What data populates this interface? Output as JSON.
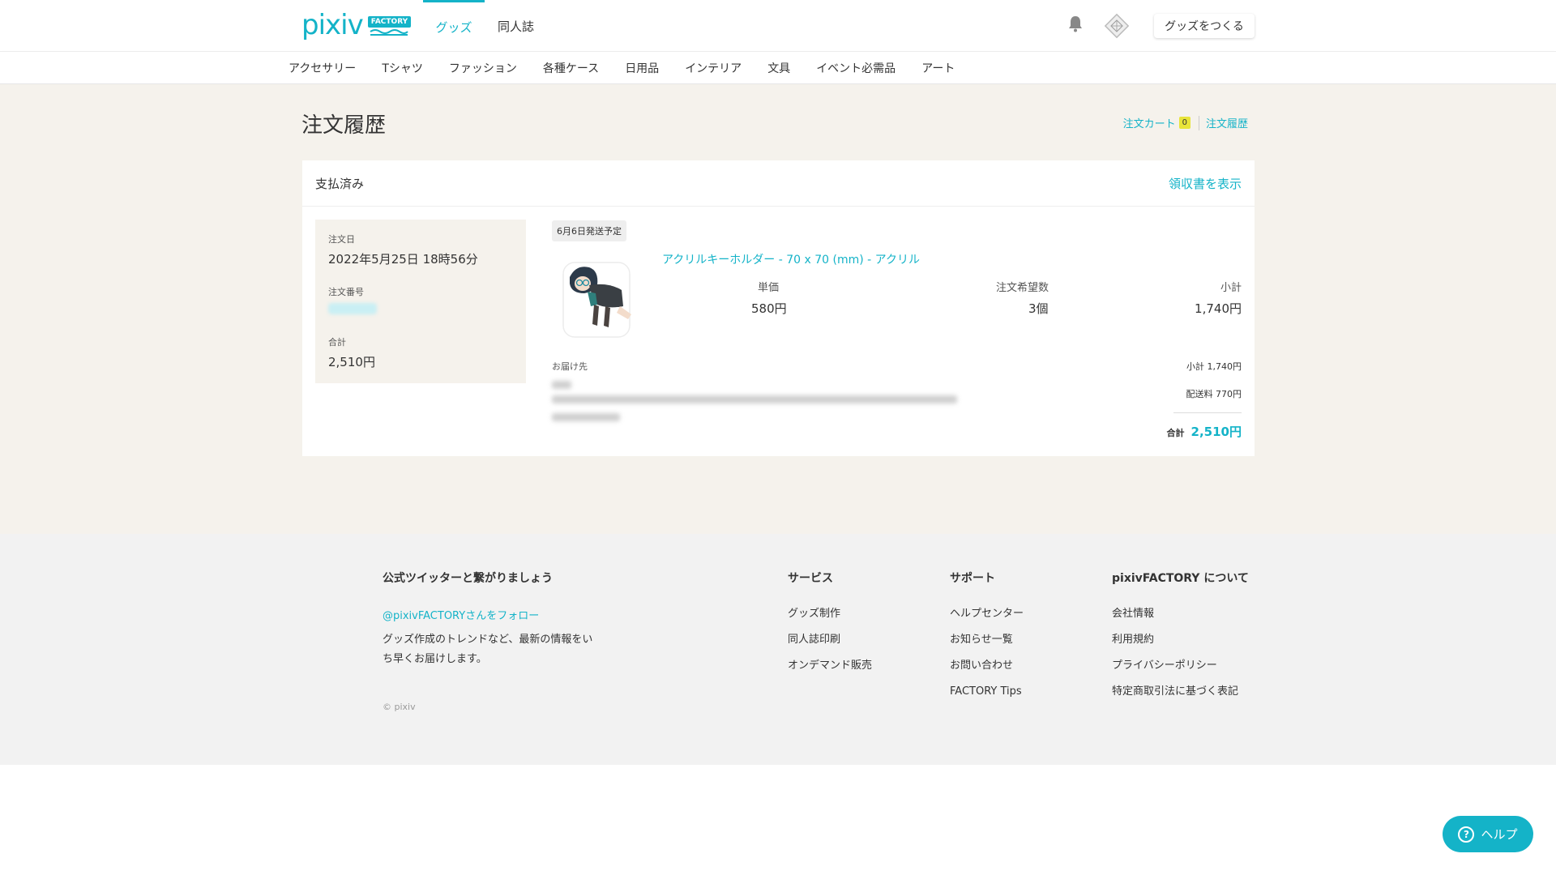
{
  "header": {
    "logo_text": "pixiv",
    "logo_tag": "FACTORY",
    "tabs": [
      {
        "label": "グッズ"
      },
      {
        "label": "同人誌"
      }
    ],
    "make_button": "グッズをつくる"
  },
  "category_nav": [
    "アクセサリー",
    "Tシャツ",
    "ファッション",
    "各種ケース",
    "日用品",
    "インテリア",
    "文具",
    "イベント必需品",
    "アート"
  ],
  "page": {
    "title": "注文履歴",
    "cart_link": "注文カート",
    "cart_count": "0",
    "history_link": "注文履歴"
  },
  "order": {
    "status": "支払済み",
    "receipt_link": "領収書を表示",
    "date_label": "注文日",
    "date_value": "2022年5月25日 18時56分",
    "number_label": "注文番号",
    "total_label": "合計",
    "total_value": "2,510円",
    "ship_badge": "6月6日発送予定",
    "product_name": "アクリルキーホルダー - 70 x 70 (mm) - アクリル",
    "unit_price_label": "単価",
    "unit_price": "580円",
    "qty_label": "注文希望数",
    "qty": "3個",
    "subtotal_label": "小計",
    "subtotal": "1,740円",
    "destination_label": "お届け先",
    "summary_subtotal": "小計 1,740円",
    "summary_shipping": "配送料 770円",
    "summary_total_label": "合計",
    "summary_total": "2,510円"
  },
  "footer": {
    "twitter_head": "公式ツイッターと繋がりましょう",
    "twitter_link": "@pixivFACTORYさんをフォロー",
    "twitter_desc": "グッズ作成のトレンドなど、最新の情報をいち早くお届けします。",
    "copyright": "© pixiv",
    "services_head": "サービス",
    "services": [
      "グッズ制作",
      "同人誌印刷",
      "オンデマンド販売"
    ],
    "support_head": "サポート",
    "support": [
      "ヘルプセンター",
      "お知らせ一覧",
      "お問い合わせ",
      "FACTORY Tips"
    ],
    "about_head": "pixivFACTORY について",
    "about": [
      "会社情報",
      "利用規約",
      "プライバシーポリシー",
      "特定商取引法に基づく表記"
    ]
  },
  "help_button": "ヘルプ",
  "colors": {
    "accent": "#14b3c8",
    "beige": "#f5f2ec",
    "badge_yellow": "#e8e43a"
  },
  "icons": [
    "bell-icon",
    "user-avatar-icon",
    "help-question-icon"
  ]
}
